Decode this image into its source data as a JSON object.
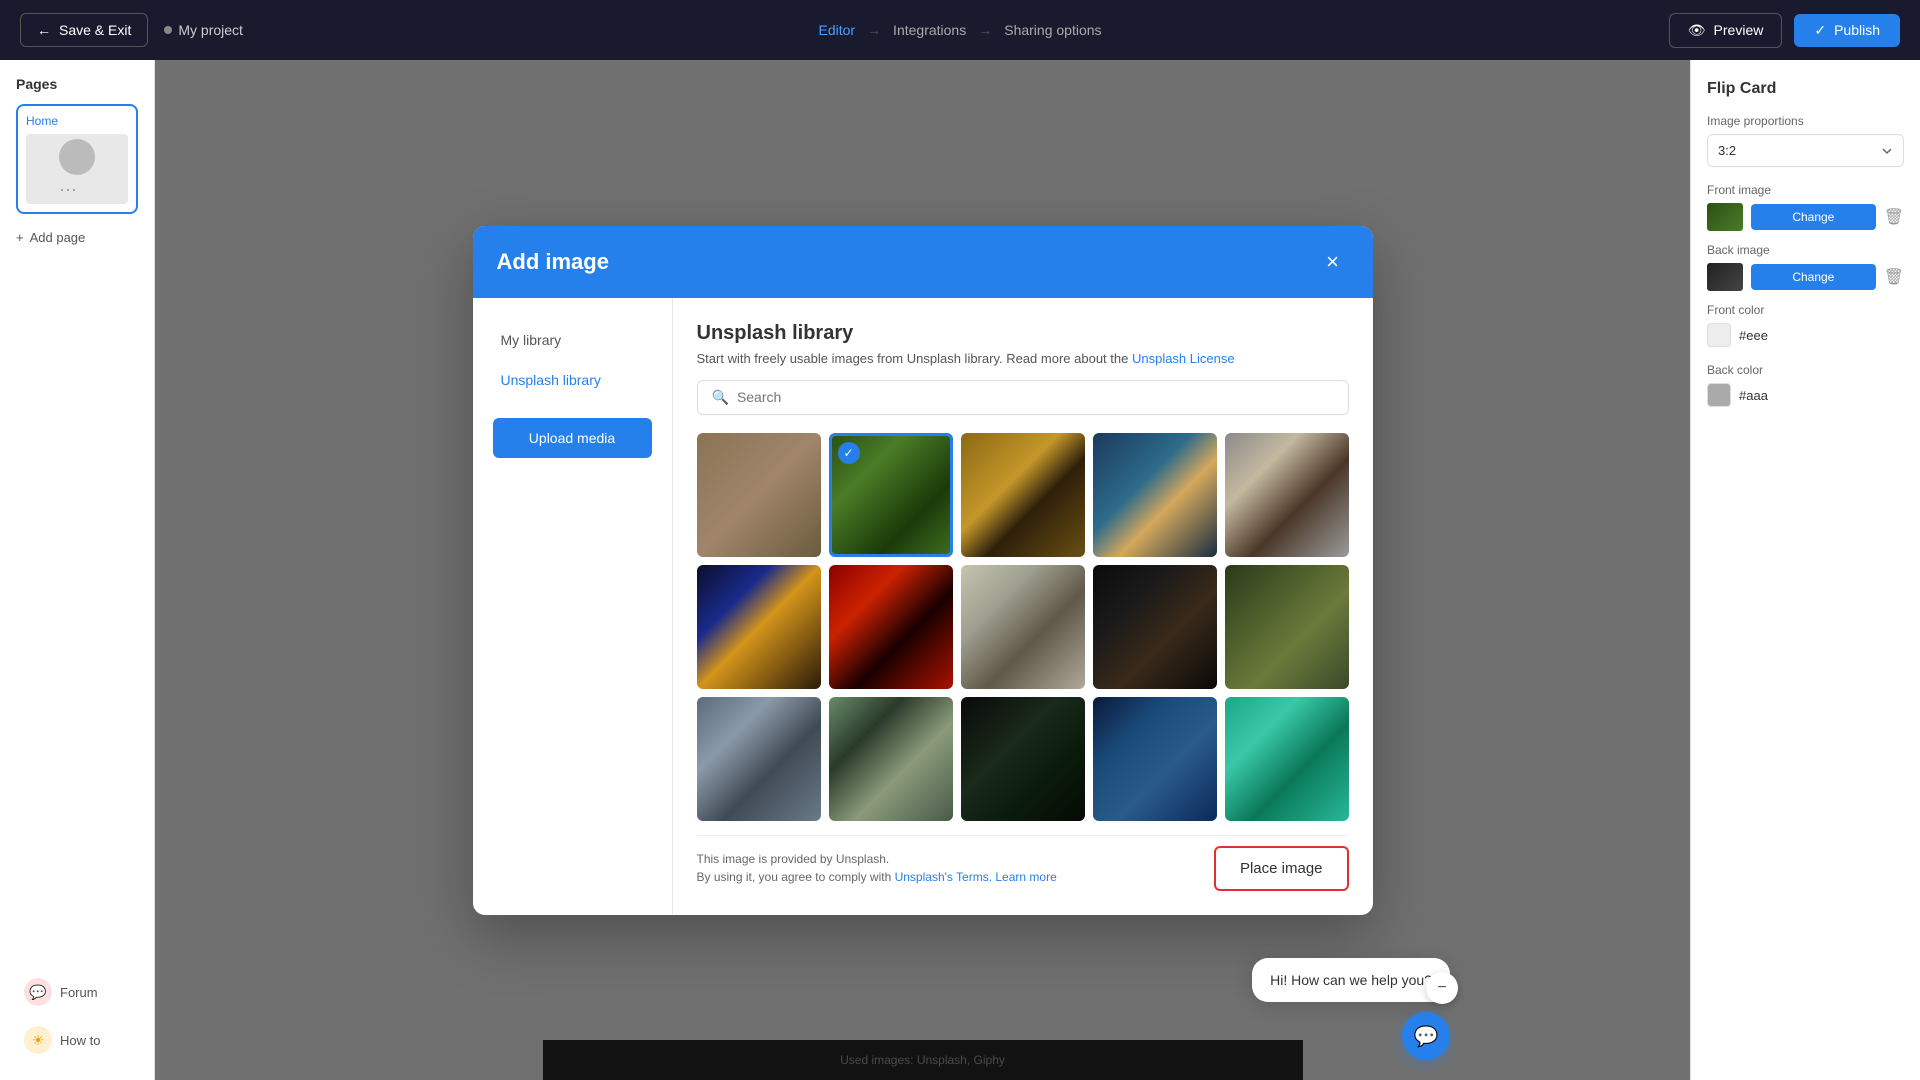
{
  "topnav": {
    "save_exit_label": "Save & Exit",
    "project_name": "My project",
    "editor_label": "Editor",
    "integrations_label": "Integrations",
    "sharing_options_label": "Sharing options",
    "preview_label": "Preview",
    "publish_label": "Publish"
  },
  "sidebar": {
    "pages_title": "Pages",
    "home_page_label": "Home",
    "add_page_label": "Add page",
    "forum_label": "Forum",
    "howto_label": "How to"
  },
  "canvas": {
    "footer_text": "Used images: Unsplash, Giphy"
  },
  "right_panel": {
    "title": "Flip Card",
    "image_proportions_label": "Image proportions",
    "image_proportions_value": "3:2",
    "front_image_label": "Front image",
    "back_image_label": "Back image",
    "change_label": "Change",
    "front_color_label": "Front color",
    "front_color_value": "#eee",
    "back_color_label": "Back color",
    "back_color_value": "#aaa"
  },
  "modal": {
    "title": "Add image",
    "close_icon": "×",
    "my_library_label": "My library",
    "unsplash_library_label": "Unsplash library",
    "upload_media_label": "Upload media",
    "unsplash_title": "Unsplash library",
    "unsplash_desc_before_link": "Start with freely usable images from Unsplash library. Read more about the ",
    "unsplash_link_label": "Unsplash License",
    "search_placeholder": "Search",
    "footer_disclaimer_line1": "This image is provided by Unsplash.",
    "footer_disclaimer_line2": "By using it, you agree to comply with ",
    "footer_link_label": "Unsplash's Terms.",
    "footer_learn_more": "Learn more",
    "place_image_label": "Place image"
  },
  "chat": {
    "message": "Hi! How can we help you?"
  }
}
